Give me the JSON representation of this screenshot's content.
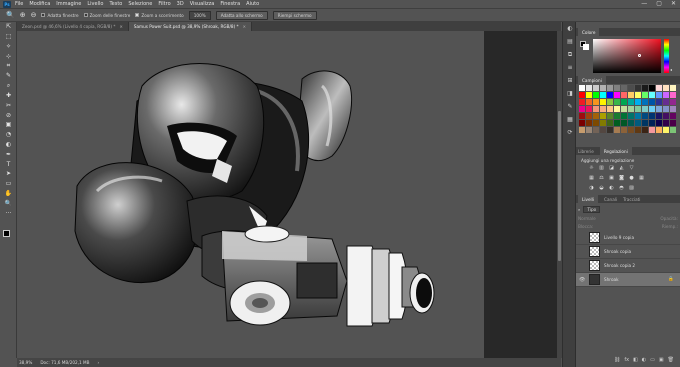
{
  "menu": {
    "logo": "Ps",
    "items": [
      "File",
      "Modifica",
      "Immagine",
      "Livello",
      "Testo",
      "Selezione",
      "Filtro",
      "3D",
      "Visualizza",
      "Finestra",
      "Aiuto"
    ],
    "win_min": "—",
    "win_max": "▢",
    "win_close": "✕"
  },
  "options": {
    "zoom_in_icon": "⊕",
    "zoom_out_icon": "⊖",
    "resize_windows": "Adatta finestre",
    "zoom_all_windows": "Zoom delle finestre",
    "scrubby_zoom": "Zoom a scorrimento",
    "percent": "100%",
    "fit_screen": "Adatta allo schermo",
    "fill_screen": "Riempi schermo"
  },
  "tabs": [
    {
      "label": "Zeon.psd @ 46,6% (Livello 4 copia, RGB/8) *",
      "active": false
    },
    {
      "label": "Samus Power Suit.psd @ 38,9% (Shroak, RGB/8) *",
      "active": true
    }
  ],
  "toolbar": {
    "tools": [
      "⇱",
      "⬚",
      "✧",
      "⊹",
      "⌗",
      "✎",
      "⌕",
      "✚",
      "✂",
      "⊘",
      "▣",
      "◔",
      "◐",
      "✒",
      "T",
      "➤",
      "▭",
      "✋",
      "🔍"
    ],
    "more": "···"
  },
  "status": {
    "zoom": "38,9%",
    "doc": "Doc: 71,6 MB/202,1 MB",
    "arrow": "›"
  },
  "dock_icons": [
    "◐",
    "▤",
    "⧉",
    "≡",
    "⊞",
    "◨",
    "✎",
    "▦",
    "⟳"
  ],
  "color_panel": {
    "title": "Colore",
    "hue_arrow": "◂"
  },
  "swatches_panel": {
    "title": "Campioni",
    "colors": [
      "#ffffff",
      "#e6e6e6",
      "#cccccc",
      "#b3b3b3",
      "#999999",
      "#808080",
      "#666666",
      "#4d4d4d",
      "#333333",
      "#1a1a1a",
      "#000000",
      "#ffd9d9",
      "#ffe0c0",
      "#fff4bf",
      "#ff0000",
      "#ffff00",
      "#00ff00",
      "#00ffff",
      "#0000ff",
      "#ff00ff",
      "#ff6666",
      "#ffcc66",
      "#ffff66",
      "#66ff66",
      "#66ffff",
      "#6699ff",
      "#cc66ff",
      "#ff66cc",
      "#ed1c24",
      "#f26522",
      "#f7941d",
      "#fff200",
      "#8dc63f",
      "#39b54a",
      "#00a651",
      "#00a99d",
      "#00aeef",
      "#0072bc",
      "#0054a6",
      "#2e3192",
      "#662d91",
      "#92278f",
      "#ec008c",
      "#ed145b",
      "#f69679",
      "#f9ad81",
      "#fdc689",
      "#fff799",
      "#c4df9b",
      "#a3d39c",
      "#82ca9c",
      "#7accc8",
      "#6dcff6",
      "#7da7d9",
      "#8393ca",
      "#a186be",
      "#9e0b0f",
      "#a0410d",
      "#a36209",
      "#aba000",
      "#598527",
      "#1a7b30",
      "#007236",
      "#00746b",
      "#0076a3",
      "#004a80",
      "#003471",
      "#1b1464",
      "#440e62",
      "#630460",
      "#790000",
      "#7b2e00",
      "#7d4900",
      "#827b00",
      "#406618",
      "#005e20",
      "#005826",
      "#005952",
      "#005b7f",
      "#003663",
      "#002157",
      "#0d004c",
      "#32004b",
      "#4b0049",
      "#c69c6d",
      "#998675",
      "#736357",
      "#534741",
      "#37302a",
      "#a67c52",
      "#8c6239",
      "#754c24",
      "#603913",
      "#3c2415",
      "#f5989d",
      "#fbaf5d",
      "#fff568",
      "#7cc576"
    ]
  },
  "adjust_panel": {
    "tabs": [
      "Librerie",
      "Regolazioni"
    ],
    "title": "Aggiungi una regolazione",
    "icons": [
      "☼",
      "▥",
      "◪",
      "◭",
      "▽",
      "",
      "▦",
      "⚖",
      "▣",
      "◙",
      "●",
      "▦",
      "◑",
      "◒",
      "◐",
      "◓",
      "▨",
      ""
    ]
  },
  "layers_panel": {
    "tabs": [
      "Livelli",
      "Canali",
      "Tracciati"
    ],
    "filter_icon": "⌕",
    "filter_kind": "Tipo",
    "blend_mode": "Normale",
    "opacity": "Opacità:",
    "lock": "Blocca:",
    "fill": "Riemp.:",
    "layers": [
      {
        "name": "Livello 9 copia",
        "visible": false,
        "selected": false,
        "dark": false
      },
      {
        "name": "Shroak copia",
        "visible": false,
        "selected": false,
        "dark": false
      },
      {
        "name": "Shroak copia 2",
        "visible": false,
        "selected": false,
        "dark": false
      },
      {
        "name": "Shroak",
        "visible": true,
        "selected": true,
        "dark": true
      }
    ],
    "eye": "👁",
    "lock_icon": "🔒",
    "footer_icons": [
      "⛓",
      "fx",
      "◧",
      "◐",
      "▭",
      "▣",
      "🗑"
    ]
  },
  "artwork": {
    "colors": {
      "canvas_bg": "#535353",
      "pasteboard": "#282828",
      "highlight": "#ffffff",
      "shadow": "#111111"
    }
  }
}
